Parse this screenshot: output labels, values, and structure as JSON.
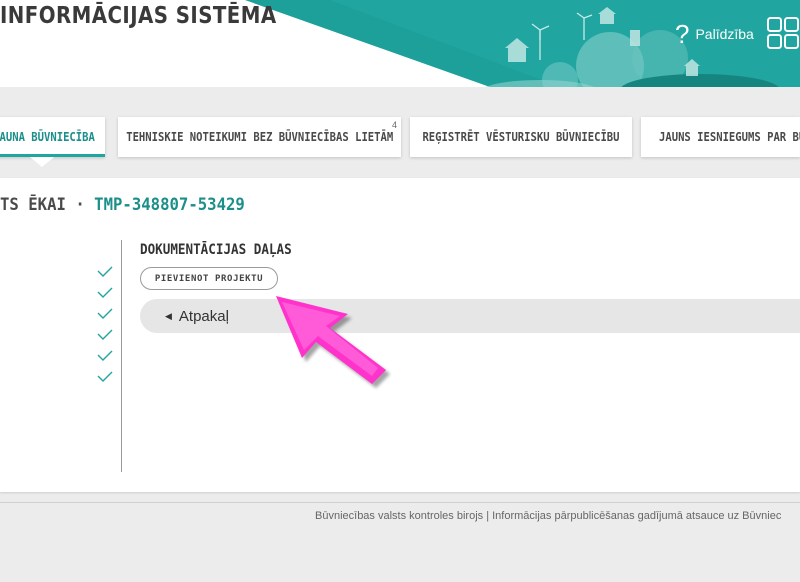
{
  "header": {
    "app_title": "INFORMĀCIJAS SISTĒMA",
    "help_label": "Palīdzība",
    "accent_color": "#20a5a0"
  },
  "tabs": [
    {
      "label": "AUNA BŪVNIECĪBA",
      "active": true,
      "badge": ""
    },
    {
      "label": "TEHNISKIE NOTEIKUMI BEZ BŪVNIECĪBAS LIETĀM",
      "active": false,
      "badge": "4"
    },
    {
      "label": "REĢISTRĒT VĒSTURISKU BŪVNIECĪBU",
      "active": false,
      "badge": ""
    },
    {
      "label": "JAUNS IESNIEGUMS PAR BŪV",
      "active": false,
      "badge": ""
    }
  ],
  "main": {
    "title_prefix": "TS ĒKAI · ",
    "title_id": "TMP-348807-53429",
    "section_title": "DOKUMENTĀCIJAS DAĻAS",
    "add_project_label": "PIEVIENOT PROJEKTU",
    "back_label": "Atpakaļ",
    "completed_steps": 6
  },
  "footer": {
    "text": "Būvniecības valsts kontroles birojs | Informācijas pārpublicēšanas gadījumā atsauce uz Būvniec"
  },
  "icons": {
    "help": "question-icon",
    "apps": "grid-icon",
    "step": "checkmark-icon",
    "back": "triangle-left-icon",
    "annotation": "pointer-arrow-icon"
  },
  "colors": {
    "annotation_arrow": "#ff33cc",
    "check": "#20a5a0"
  }
}
